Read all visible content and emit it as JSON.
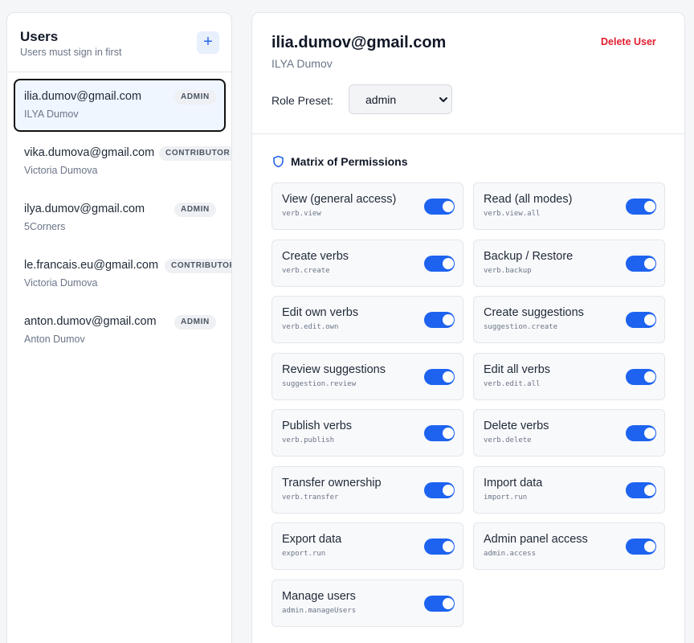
{
  "users_panel": {
    "title": "Users",
    "subtitle": "Users must sign in first",
    "add_icon": "plus-icon",
    "add_glyph": "+",
    "users": [
      {
        "email": "ilia.dumov@gmail.com",
        "name": "ILYA Dumov",
        "role": "ADMIN",
        "selected": true
      },
      {
        "email": "vika.dumova@gmail.com",
        "name": "Victoria Dumova",
        "role": "CONTRIBUTOR",
        "selected": false
      },
      {
        "email": "ilya.dumov@gmail.com",
        "name": "5Corners",
        "role": "ADMIN",
        "selected": false
      },
      {
        "email": "le.francais.eu@gmail.com",
        "name": "Victoria Dumova",
        "role": "CONTRIBUTOR",
        "selected": false
      },
      {
        "email": "anton.dumov@gmail.com",
        "name": "Anton Dumov",
        "role": "ADMIN",
        "selected": false
      }
    ]
  },
  "detail": {
    "email": "ilia.dumov@gmail.com",
    "name": "ILYA Dumov",
    "delete_label": "Delete User",
    "preset_label": "Role Preset:",
    "preset_value": "admin",
    "matrix_title": "Matrix of Permissions",
    "matrix_icon": "shield-icon",
    "permissions": [
      {
        "label": "View (general access)",
        "key": "verb.view",
        "enabled": true
      },
      {
        "label": "Read (all modes)",
        "key": "verb.view.all",
        "enabled": true
      },
      {
        "label": "Create verbs",
        "key": "verb.create",
        "enabled": true
      },
      {
        "label": "Backup / Restore",
        "key": "verb.backup",
        "enabled": true
      },
      {
        "label": "Edit own verbs",
        "key": "verb.edit.own",
        "enabled": true
      },
      {
        "label": "Create suggestions",
        "key": "suggestion.create",
        "enabled": true
      },
      {
        "label": "Review suggestions",
        "key": "suggestion.review",
        "enabled": true
      },
      {
        "label": "Edit all verbs",
        "key": "verb.edit.all",
        "enabled": true
      },
      {
        "label": "Publish verbs",
        "key": "verb.publish",
        "enabled": true
      },
      {
        "label": "Delete verbs",
        "key": "verb.delete",
        "enabled": true
      },
      {
        "label": "Transfer ownership",
        "key": "verb.transfer",
        "enabled": true
      },
      {
        "label": "Import data",
        "key": "import.run",
        "enabled": true
      },
      {
        "label": "Export data",
        "key": "export.run",
        "enabled": true
      },
      {
        "label": "Admin panel access",
        "key": "admin.access",
        "enabled": true
      },
      {
        "label": "Manage users",
        "key": "admin.manageUsers",
        "enabled": true
      }
    ]
  },
  "colors": {
    "accent": "#1d63f0",
    "danger": "#e11d2e",
    "selected_bg": "#eff6ff"
  }
}
